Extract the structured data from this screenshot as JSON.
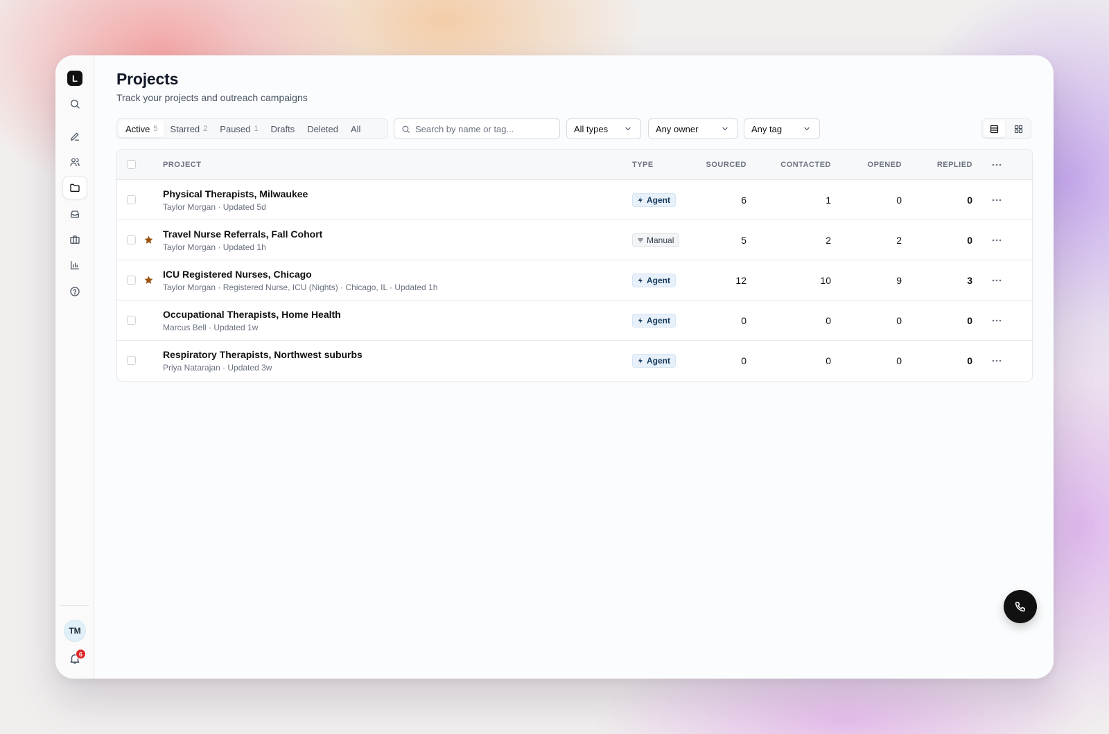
{
  "sidebar": {
    "logo_letter": "L",
    "nav": [
      {
        "name": "search",
        "icon": "search-icon",
        "active": false
      },
      {
        "name": "compose",
        "icon": "pencil-icon",
        "active": false
      },
      {
        "name": "people",
        "icon": "users-icon",
        "active": false
      },
      {
        "name": "projects",
        "icon": "folder-icon",
        "active": true
      },
      {
        "name": "inbox",
        "icon": "inbox-icon",
        "active": false
      },
      {
        "name": "jobs",
        "icon": "briefcase-icon",
        "active": false
      },
      {
        "name": "analytics",
        "icon": "bar-chart-icon",
        "active": false
      },
      {
        "name": "help",
        "icon": "help-circle-icon",
        "active": false
      }
    ],
    "user_initials": "TM",
    "notification_count": "6"
  },
  "header": {
    "title": "Projects",
    "subtitle": "Track your projects and outreach campaigns"
  },
  "tabs": [
    {
      "label": "Active",
      "count": "5",
      "active": true
    },
    {
      "label": "Starred",
      "count": "2",
      "active": false
    },
    {
      "label": "Paused",
      "count": "1",
      "active": false
    },
    {
      "label": "Drafts",
      "count": "",
      "active": false
    },
    {
      "label": "Deleted",
      "count": "",
      "active": false
    },
    {
      "label": "All",
      "count": "",
      "active": false
    }
  ],
  "search": {
    "placeholder": "Search by name or tag...",
    "value": ""
  },
  "filters": {
    "type": "All types",
    "owner": "Any owner",
    "tag": "Any tag"
  },
  "table": {
    "columns": {
      "project": "PROJECT",
      "type": "TYPE",
      "sourced": "SOURCED",
      "contacted": "CONTACTED",
      "opened": "OPENED",
      "replied": "REPLIED"
    },
    "rows": [
      {
        "name": "Physical Therapists, Milwaukee",
        "meta": "Taylor Morgan · Updated 5d",
        "starred": false,
        "type": "Agent",
        "sourced": "6",
        "contacted": "1",
        "opened": "0",
        "replied": "0"
      },
      {
        "name": "Travel Nurse Referrals, Fall Cohort",
        "meta": "Taylor Morgan · Updated 1h",
        "starred": true,
        "type": "Manual",
        "sourced": "5",
        "contacted": "2",
        "opened": "2",
        "replied": "0"
      },
      {
        "name": "ICU Registered Nurses, Chicago",
        "meta": "Taylor Morgan · Registered Nurse, ICU (Nights) · Chicago, IL · Updated 1h",
        "starred": true,
        "type": "Agent",
        "sourced": "12",
        "contacted": "10",
        "opened": "9",
        "replied": "3"
      },
      {
        "name": "Occupational Therapists, Home Health",
        "meta": "Marcus Bell · Updated 1w",
        "starred": false,
        "type": "Agent",
        "sourced": "0",
        "contacted": "0",
        "opened": "0",
        "replied": "0"
      },
      {
        "name": "Respiratory Therapists, Northwest suburbs",
        "meta": "Priya Natarajan · Updated 3w",
        "starred": false,
        "type": "Agent",
        "sourced": "0",
        "contacted": "0",
        "opened": "0",
        "replied": "0"
      }
    ]
  },
  "colors": {
    "star": "#9a5512",
    "agent_badge_bg": "#e8f1fa",
    "notification_badge": "#dc2626"
  }
}
